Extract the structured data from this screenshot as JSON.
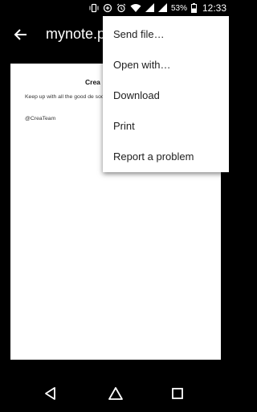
{
  "status_bar": {
    "battery_percent": "53%",
    "time": "12:33",
    "icons": [
      "vibrate-icon",
      "data-saver-icon",
      "alarm-icon",
      "wifi-icon",
      "signal-icon",
      "signal-icon",
      "battery-icon"
    ]
  },
  "app_bar": {
    "title": "mynote.pdf",
    "back_icon": "arrow-back-icon"
  },
  "document": {
    "heading": "Crea",
    "body": "Keep up with all the good de soooooon !!",
    "signature": "@CreaTeam"
  },
  "menu": {
    "items": [
      {
        "label": "Send file…"
      },
      {
        "label": "Open with…"
      },
      {
        "label": "Download"
      },
      {
        "label": "Print"
      },
      {
        "label": "Report a problem"
      }
    ]
  },
  "nav_bar": {
    "icons": [
      "nav-back-icon",
      "nav-home-icon",
      "nav-recents-icon"
    ]
  }
}
